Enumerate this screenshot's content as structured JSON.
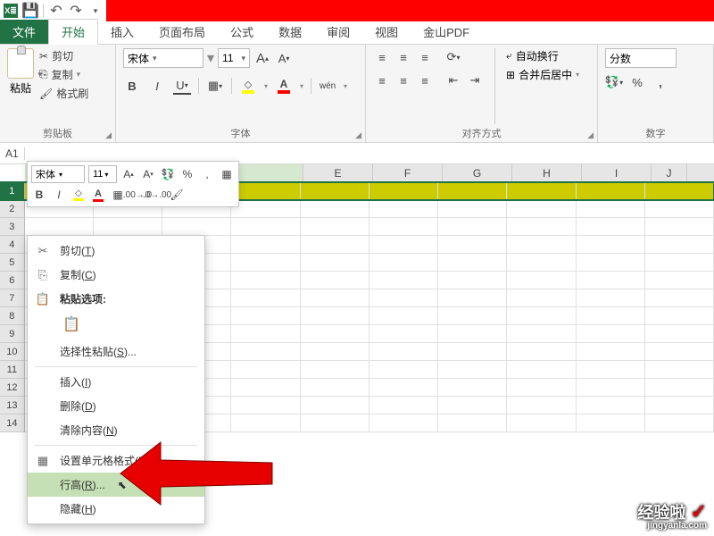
{
  "tabs": {
    "file": "文件",
    "home": "开始",
    "insert": "插入",
    "layout": "页面布局",
    "formula": "公式",
    "data": "数据",
    "review": "审阅",
    "view": "视图",
    "pdf": "金山PDF"
  },
  "ribbon": {
    "clipboard": {
      "label": "剪贴板",
      "paste": "粘贴",
      "cut": "剪切",
      "copy": "复制",
      "format_painter": "格式刷"
    },
    "font": {
      "label": "字体",
      "name": "宋体",
      "size": "11",
      "bold": "B",
      "italic": "I",
      "underline": "U",
      "wen": "wén"
    },
    "align": {
      "label": "对齐方式",
      "wrap": "自动换行",
      "merge": "合并后居中"
    },
    "number": {
      "label": "数字",
      "format": "分数",
      "percent": "%",
      "comma": ","
    }
  },
  "mini": {
    "font": "宋体",
    "size": "11"
  },
  "namebox": "A1",
  "cols": [
    "E",
    "F",
    "G",
    "H",
    "I",
    "J"
  ],
  "rows": [
    "1",
    "2",
    "3",
    "4",
    "5",
    "6",
    "7",
    "8",
    "9",
    "10",
    "11",
    "12",
    "13",
    "14"
  ],
  "ctx": {
    "cut": "剪切(T)",
    "copy": "复制(C)",
    "paste_opts": "粘贴选项:",
    "paste_special": "选择性粘贴(S)...",
    "insert": "插入(I)",
    "delete": "删除(D)",
    "clear": "清除内容(N)",
    "format_cells": "设置单元格格式(F)...",
    "row_height": "行高(R)...",
    "hide": "隐藏(H)"
  },
  "watermark": {
    "main": "经验啦",
    "sub": "jingyanla.com"
  }
}
